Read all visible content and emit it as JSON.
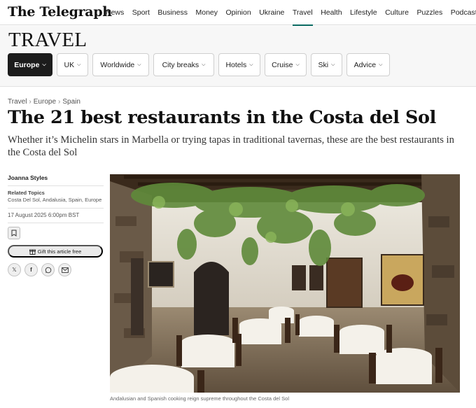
{
  "brand": {
    "logo": "The Telegraph"
  },
  "nav": {
    "items": [
      "News",
      "Sport",
      "Business",
      "Money",
      "Opinion",
      "Ukraine",
      "Travel",
      "Health",
      "Lifestyle",
      "Culture",
      "Puzzles",
      "Podcasts"
    ],
    "active": "Travel"
  },
  "section": {
    "title": "TRAVEL"
  },
  "subnav": {
    "pills": [
      "Europe",
      "UK",
      "Worldwide",
      "City breaks",
      "Hotels",
      "Cruise",
      "Ski",
      "Advice"
    ],
    "active": "Europe"
  },
  "breadcrumb": [
    "Travel",
    "Europe",
    "Spain"
  ],
  "article": {
    "headline": "The 21 best restaurants in the Costa del Sol",
    "standfirst": "Whether it’s Michelin stars in Marbella or trying tapas in traditional tavernas, these are the best restaurants in the Costa del Sol",
    "author": "Joanna Styles",
    "related_label": "Related Topics",
    "related_topics": "Costa Del Sol, Andalusia, Spain, Europe",
    "date": "17 August 2025 6:00pm BST",
    "gift_label": "Gift this article free",
    "share": [
      "X",
      "Facebook",
      "WhatsApp",
      "Email"
    ],
    "image_caption": "Andalusian and Spanish cooking reign supreme throughout the Costa del Sol"
  },
  "icons": {
    "bookmark": "bookmark-icon",
    "gift": "gift-icon",
    "x": "x-icon",
    "facebook": "facebook-icon",
    "whatsapp": "whatsapp-icon",
    "email": "email-icon"
  },
  "colors": {
    "active_underline": "#0b6b62",
    "active_pill": "#1c1c1c"
  }
}
